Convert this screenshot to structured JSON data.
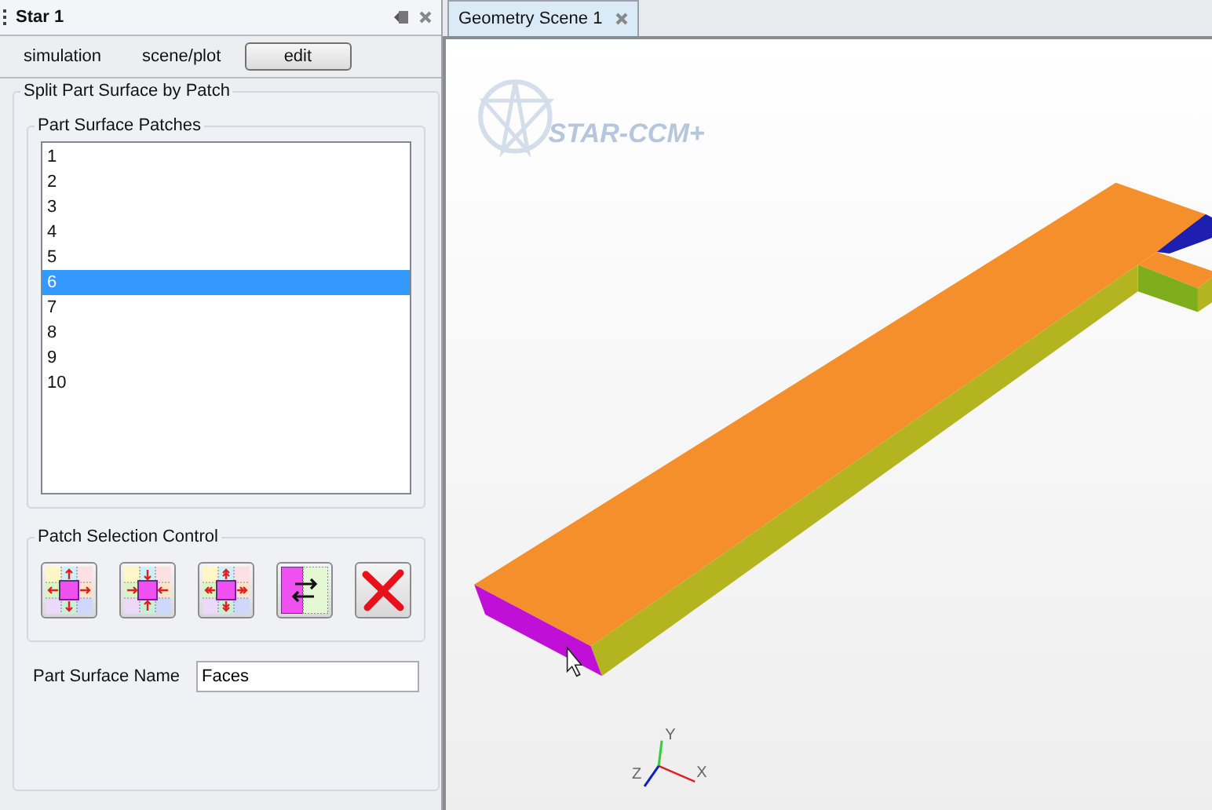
{
  "left_panel": {
    "title": "Star 1",
    "tabs": [
      {
        "label": "simulation",
        "selected": false
      },
      {
        "label": "scene/plot",
        "selected": false
      },
      {
        "label": "edit",
        "selected": true
      }
    ],
    "group": {
      "title": "Split Part Surface by Patch",
      "patches": {
        "title": "Part Surface Patches",
        "items": [
          {
            "label": "1",
            "selected": false
          },
          {
            "label": "2",
            "selected": false
          },
          {
            "label": "3",
            "selected": false
          },
          {
            "label": "4",
            "selected": false
          },
          {
            "label": "5",
            "selected": false
          },
          {
            "label": "6",
            "selected": true
          },
          {
            "label": "7",
            "selected": false
          },
          {
            "label": "8",
            "selected": false
          },
          {
            "label": "9",
            "selected": false
          },
          {
            "label": "10",
            "selected": false
          }
        ]
      },
      "selection_control": {
        "title": "Patch Selection Control",
        "buttons": [
          {
            "kind": "grow"
          },
          {
            "kind": "shrink"
          },
          {
            "kind": "grow-more"
          },
          {
            "kind": "swap"
          },
          {
            "kind": "delete"
          }
        ]
      },
      "name_field": {
        "label": "Part Surface Name",
        "value": "Faces"
      }
    }
  },
  "scene": {
    "tab": {
      "label": "Geometry Scene 1",
      "selected": true
    },
    "logo": "STAR-CCM+",
    "axes": {
      "x": "X",
      "y": "Y",
      "z": "Z"
    }
  }
}
